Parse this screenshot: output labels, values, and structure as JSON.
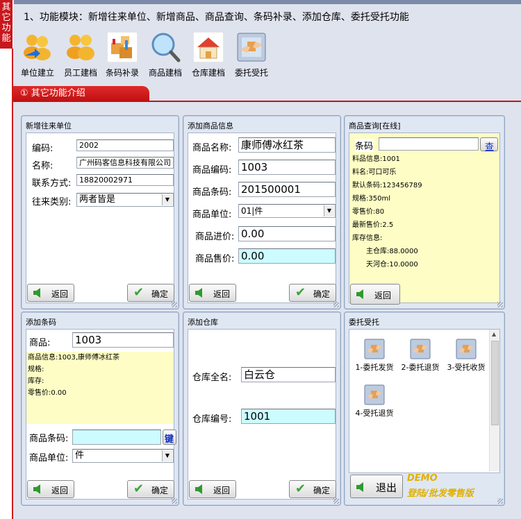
{
  "sidebar_tab": "其它功能",
  "heading": "1、功能模块：新增往来单位、新增商品、商品查询、条码补录、添加仓库、委托受托功能",
  "modules": [
    {
      "label": "单位建立",
      "icon": "users-icon"
    },
    {
      "label": "员工建档",
      "icon": "staff-icon"
    },
    {
      "label": "条码补录",
      "icon": "boxes-icon"
    },
    {
      "label": "商品建档",
      "icon": "magnifier-icon"
    },
    {
      "label": "仓库建档",
      "icon": "warehouse-icon"
    },
    {
      "label": "委托受托",
      "icon": "handshake-icon"
    }
  ],
  "section_title": "① 其它功能介绍",
  "unit_panel": {
    "title": "新增往来单位",
    "fields": [
      {
        "label": "编码:",
        "value": "2002"
      },
      {
        "label": "名称:",
        "value": "广州码客信息科技有限公司"
      },
      {
        "label": "联系方式:",
        "value": "18820002971"
      },
      {
        "label": "往来类别:",
        "value": "两者皆是"
      }
    ],
    "back": "返回",
    "ok": "确定"
  },
  "product_panel": {
    "title": "添加商品信息",
    "fields": [
      {
        "label": "商品名称:",
        "value": "康师傅冰红茶"
      },
      {
        "label": "商品编码:",
        "value": "1003"
      },
      {
        "label": "商品条码:",
        "value": "201500001"
      },
      {
        "label": "商品单位:",
        "value": "01|件"
      },
      {
        "label": "商品进价:",
        "value": "0.00"
      },
      {
        "label": "商品售价:",
        "value": "0.00"
      }
    ],
    "back": "返回",
    "ok": "确定"
  },
  "query_panel": {
    "title": "商品查询[在线]",
    "barcode_label": "条码",
    "search_btn": "查",
    "info": [
      "料品信息:1001",
      "料名:可口可乐",
      "默认条码:123456789",
      "规格:350ml",
      "零售价:80",
      "最新售价:2.5",
      "库存信息:",
      "主仓库:88.0000",
      "天河仓:10.0000"
    ],
    "back": "返回"
  },
  "barcode_panel": {
    "title": "添加条码",
    "product_label": "商品:",
    "product_value": "1003",
    "info": [
      "商品信息:1003,康师傅冰红茶",
      "规格:",
      "库存:",
      "零售价:0.00"
    ],
    "barcode_label": "商品条码:",
    "key_btn": "键",
    "unit_label": "商品单位:",
    "unit_value": "件",
    "back": "返回",
    "ok": "确定"
  },
  "warehouse_panel": {
    "title": "添加仓库",
    "name_label": "仓库全名:",
    "name_value": "白云仓",
    "code_label": "仓库编号:",
    "code_value": "1001",
    "back": "返回",
    "ok": "确定"
  },
  "entrust_panel": {
    "title": "委托受托",
    "items": [
      "1-委托发货",
      "2-委托退货",
      "3-受托收货",
      "4-受托退货"
    ],
    "exit": "退出",
    "demo1": "DEMO",
    "demo2": "登陆/批发零售版"
  }
}
